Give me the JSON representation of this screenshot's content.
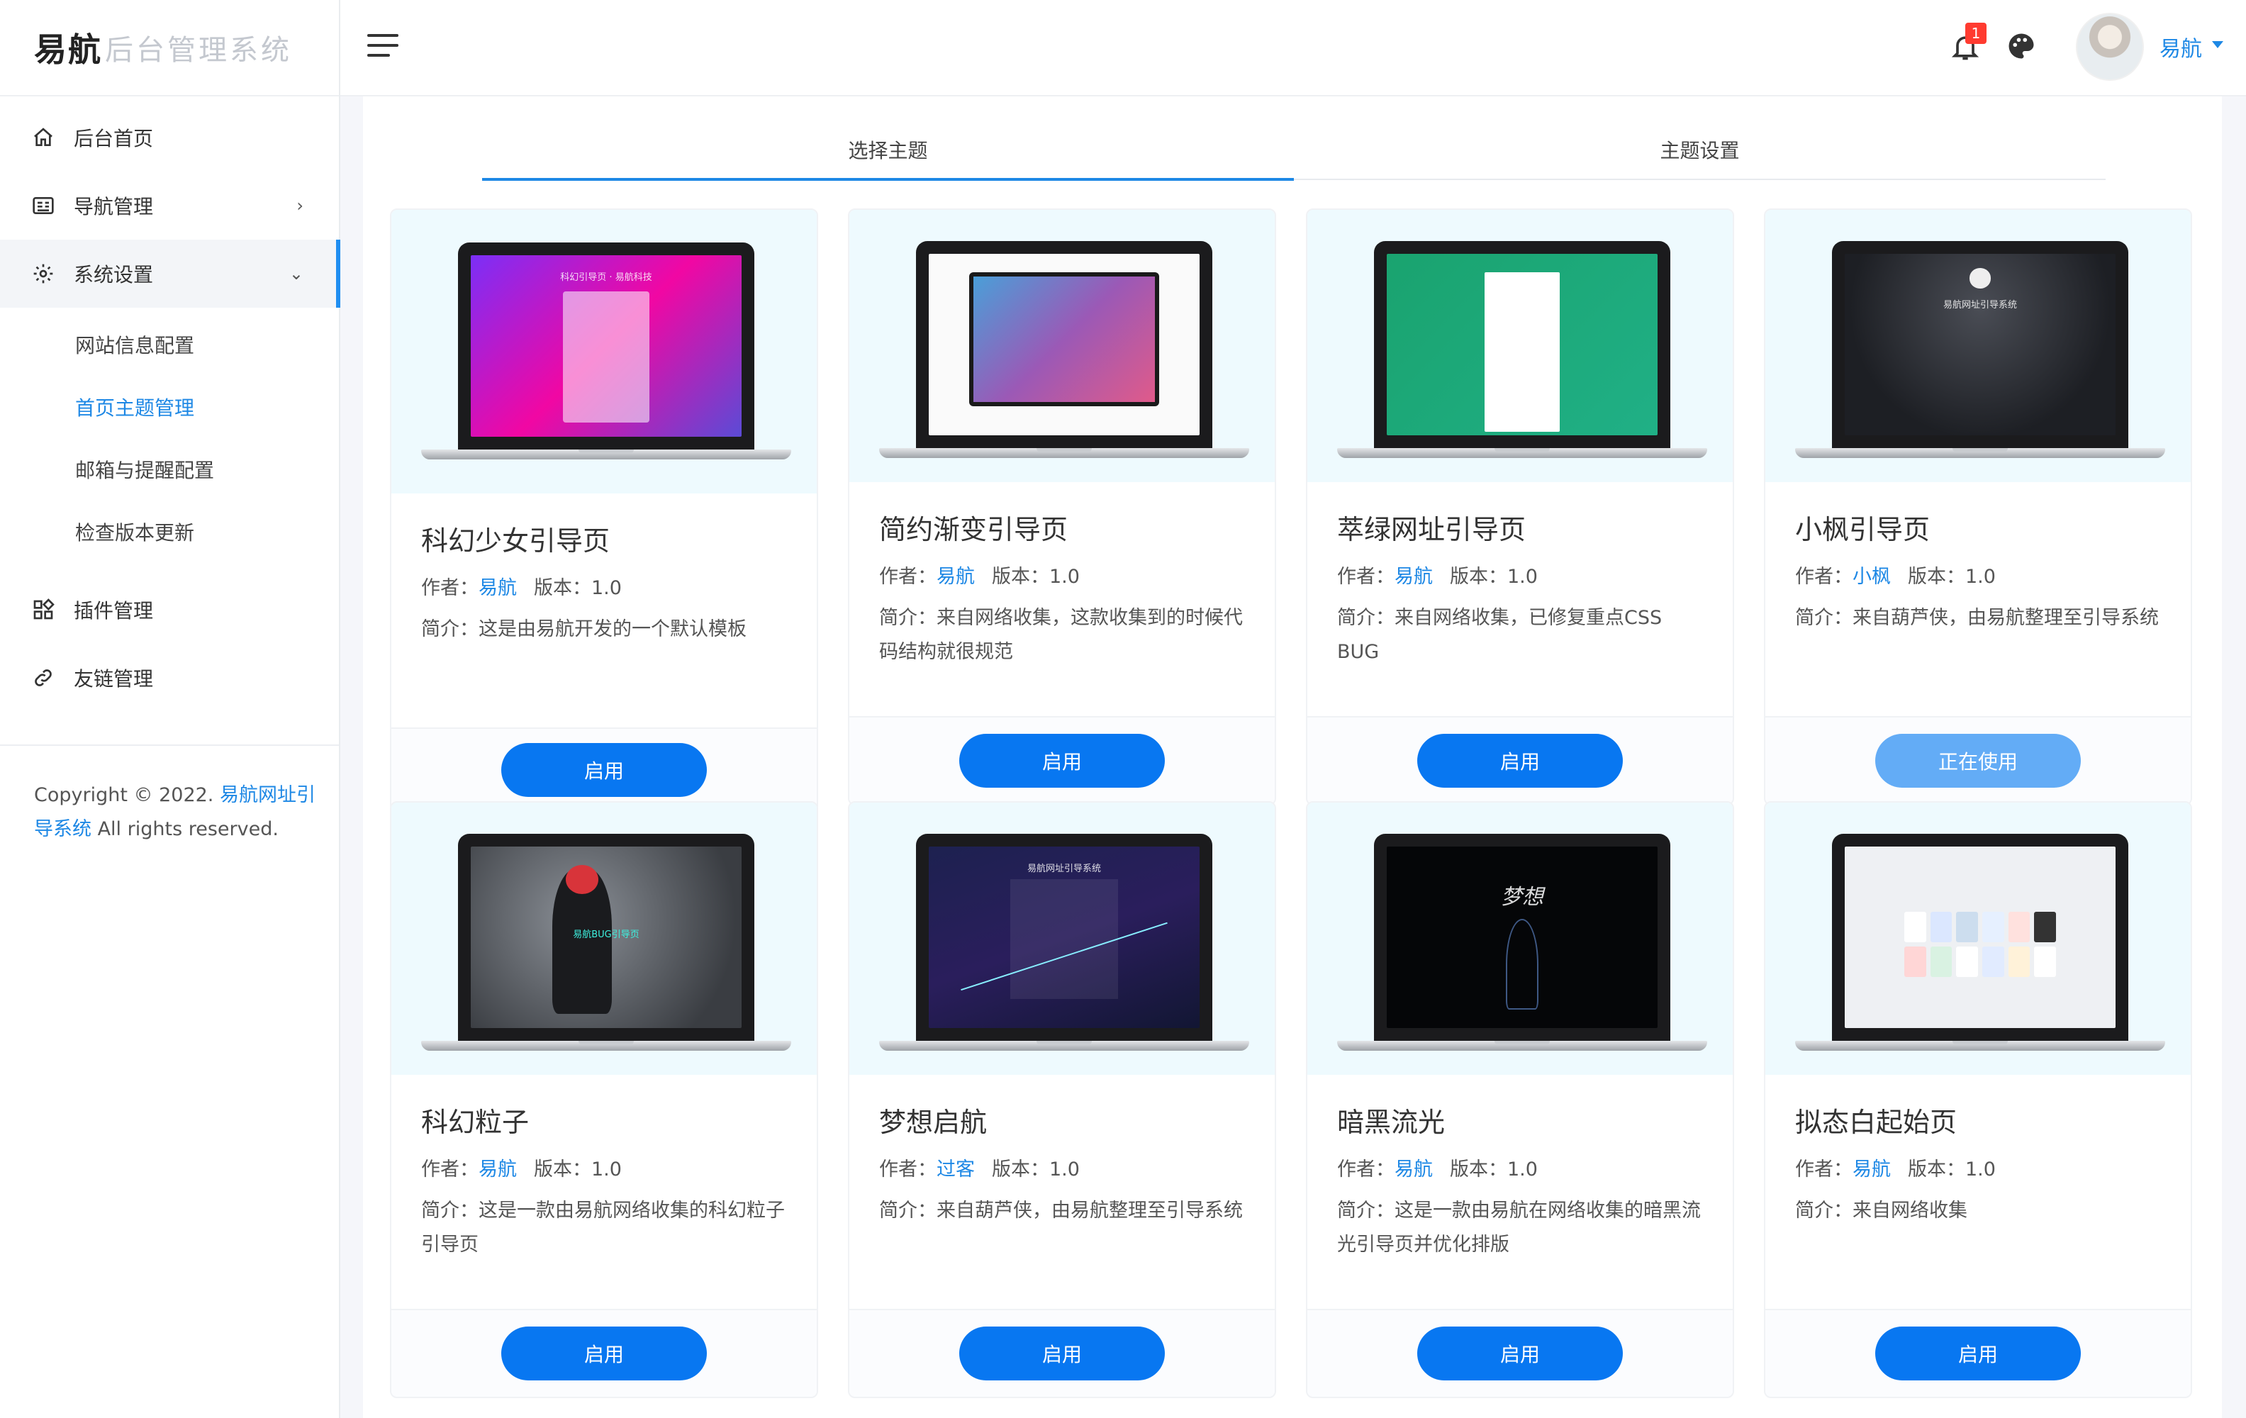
{
  "brand": {
    "main": "易航",
    "sub": "后台管理系统"
  },
  "sidebar": {
    "items": [
      {
        "label": "后台首页"
      },
      {
        "label": "导航管理"
      },
      {
        "label": "系统设置"
      },
      {
        "label": "插件管理"
      },
      {
        "label": "友链管理"
      }
    ],
    "system_submenu": [
      {
        "label": "网站信息配置"
      },
      {
        "label": "首页主题管理"
      },
      {
        "label": "邮箱与提醒配置"
      },
      {
        "label": "检查版本更新"
      }
    ],
    "copyright": {
      "prefix": "Copyright © 2022. ",
      "link": "易航网址引导系统",
      "suffix": " All rights reserved."
    }
  },
  "header": {
    "notification_count": "1",
    "user_name": "易航"
  },
  "tabs": [
    {
      "label": "选择主题"
    },
    {
      "label": "主题设置"
    }
  ],
  "labels": {
    "author": "作者：",
    "version": "版本：",
    "desc": "简介："
  },
  "themes": [
    {
      "title": "科幻少女引导页",
      "author": "易航",
      "version": "1.0",
      "desc": "这是由易航开发的一个默认模板",
      "button": "启用",
      "screen_text": "科幻引导页 · 易航科技"
    },
    {
      "title": "简约渐变引导页",
      "author": "易航",
      "version": "1.0",
      "desc": "来自网络收集，这款收集到的时候代码结构就很规范",
      "button": "启用",
      "screen_text": ""
    },
    {
      "title": "萃绿网址引导页",
      "author": "易航",
      "version": "1.0",
      "desc": "来自网络收集，已修复重点CSS BUG",
      "button": "启用",
      "screen_text": ""
    },
    {
      "title": "小枫引导页",
      "author": "小枫",
      "version": "1.0",
      "desc": "来自葫芦侠，由易航整理至引导系统",
      "button": "正在使用",
      "screen_text": "易航网址引导系统"
    },
    {
      "title": "科幻粒子",
      "author": "易航",
      "version": "1.0",
      "desc": "这是一款由易航网络收集的科幻粒子引导页",
      "button": "启用",
      "screen_text": "易航BUG引导页"
    },
    {
      "title": "梦想启航",
      "author": "过客",
      "version": "1.0",
      "desc": "来自葫芦侠，由易航整理至引导系统",
      "button": "启用",
      "screen_text": "易航网址引导系统"
    },
    {
      "title": "暗黑流光",
      "author": "易航",
      "version": "1.0",
      "desc": "这是一款由易航在网络收集的暗黑流光引导页并优化排版",
      "button": "启用",
      "screen_text": "梦想"
    },
    {
      "title": "拟态白起始页",
      "author": "易航",
      "version": "1.0",
      "desc": "来自网络收集",
      "button": "启用",
      "screen_text": ""
    }
  ],
  "colors": {
    "accent": "#1e88e5",
    "button": "#0877f1",
    "button_active": "#63acf6",
    "badge": "#ff3b30"
  }
}
